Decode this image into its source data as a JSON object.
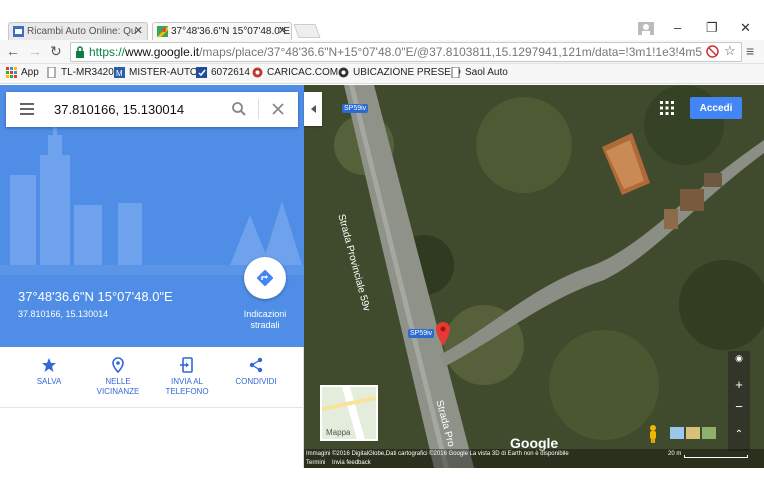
{
  "tabs": [
    {
      "title": "Ricambi Auto Online: Qu",
      "close": "✕"
    },
    {
      "title": "37°48'36.6\"N 15°07'48.0\"E",
      "close": "✕"
    }
  ],
  "address": {
    "scheme": "https://",
    "host": "www.google.it",
    "rest": "/maps/place/37°48'36.6\"N+15°07'48.0\"E/@37.8103811,15.1297941,121m/data=!3m1!1e3!4m5"
  },
  "bookmarks": [
    {
      "label": "App",
      "icon": "apps-grid-icon"
    },
    {
      "label": "TL-MR3420",
      "icon": "page-icon"
    },
    {
      "label": "MISTER-AUTO",
      "icon": "mister-auto-icon"
    },
    {
      "label": "6072614",
      "icon": "bookmark-icon"
    },
    {
      "label": "CARICAC.COM",
      "icon": "cog-logo-icon"
    },
    {
      "label": "UBICAZIONE PRESE D",
      "icon": "cog-logo-icon"
    },
    {
      "label": "Saol Auto",
      "icon": "page-icon"
    }
  ],
  "search": {
    "value": "37.810166, 15.130014"
  },
  "place": {
    "title": "37°48'36.6\"N 15°07'48.0\"E",
    "decimal": "37.810166, 15.130014",
    "directions_label": "Indicazioni stradali"
  },
  "actions": [
    {
      "label": "SALVA",
      "icon": "star-icon"
    },
    {
      "label": "NELLE VICINANZE",
      "icon": "nearby-pin-icon"
    },
    {
      "label": "INVIA AL TELEFONO",
      "icon": "send-to-phone-icon"
    },
    {
      "label": "CONDIVIDI",
      "icon": "share-icon"
    }
  ],
  "map": {
    "sign_in": "Accedi",
    "road_badges": [
      "SP59iv",
      "SP59iv"
    ],
    "road_names": [
      "Strada Provinciale 59v",
      "Strada Pro"
    ],
    "minimap_label": "Mappa",
    "logo": "Google",
    "attribution": "Immagini ©2016 DigitalGlobe,Dati cartografici ©2016 Google    La vista 3D di Earth non è disponibile",
    "terms": "Termini",
    "feedback": "Invia feedback",
    "scale": "20 m"
  },
  "colors": {
    "accent": "#4285f4",
    "panel_blue": "#4f8de6",
    "pin": "#e53935"
  }
}
